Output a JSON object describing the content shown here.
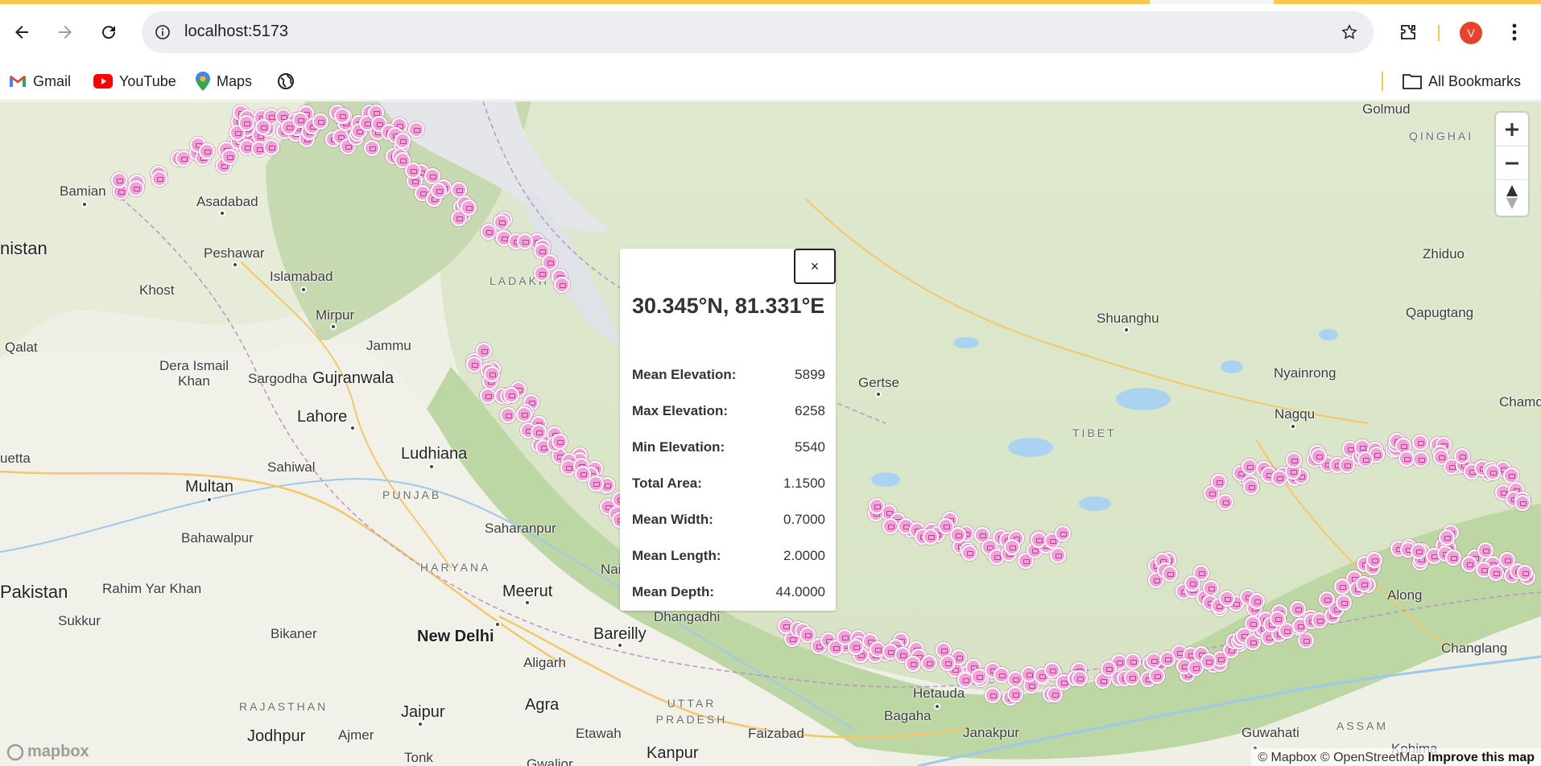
{
  "browser": {
    "url": "localhost:5173",
    "avatar_letter": "V",
    "bookmarks": [
      "Gmail",
      "YouTube",
      "Maps"
    ],
    "all_bookmarks_label": "All Bookmarks"
  },
  "map": {
    "place_labels": [
      "Bamian",
      "Asadabad",
      "nistan",
      "Peshawar",
      "Islamabad",
      "Khost",
      "Mirpur",
      "Jammu",
      "Qalat",
      "Dera Ismail Khan",
      "Sargodha",
      "Gujranwala",
      "Lahore",
      "Ludhiana",
      "Sahiwal",
      "Multan",
      "uetta",
      "Bahawalpur",
      "Pakistan",
      "Rahim Yar Khan",
      "Sukkur",
      "Bikaner",
      "Jodhpur",
      "Ajmer",
      "Jaipur",
      "Agra",
      "Aligarh",
      "Bareilly",
      "Meerut",
      "New Delhi",
      "Saharanpur",
      "Nainital",
      "Dhangadhi",
      "Etawah",
      "Kanpur",
      "Faizabad",
      "Bagaha",
      "Hetauda",
      "Janakpur",
      "Guwahati",
      "Changlang",
      "Along",
      "Nagqu",
      "Nyainrong",
      "Shuanghu",
      "Gertse",
      "Golmud",
      "Zhiduo",
      "Qapugtang",
      "Chamd",
      "Tonk",
      "Gwalior",
      "Kohima"
    ],
    "region_labels": [
      "LADAKH",
      "PUNJAB",
      "HARYANA",
      "UTTAR PRADESH",
      "RAJASTHAN",
      "TIBET",
      "QINGHAI",
      "ASSAM"
    ],
    "attribution": {
      "mapbox": "© Mapbox",
      "osm": "© OpenStreetMap",
      "improve": "Improve this map"
    },
    "logo": "mapbox"
  },
  "popup": {
    "close_label": "×",
    "coords": "30.345°N, 81.331°E",
    "rows": [
      {
        "key": "Mean Elevation:",
        "value": "5899"
      },
      {
        "key": "Max Elevation:",
        "value": "6258"
      },
      {
        "key": "Min Elevation:",
        "value": "5540"
      },
      {
        "key": "Total Area:",
        "value": "1.1500"
      },
      {
        "key": "Mean Width:",
        "value": "0.7000"
      },
      {
        "key": "Mean Length:",
        "value": "2.0000"
      },
      {
        "key": "Mean Depth:",
        "value": "44.0000"
      }
    ]
  }
}
